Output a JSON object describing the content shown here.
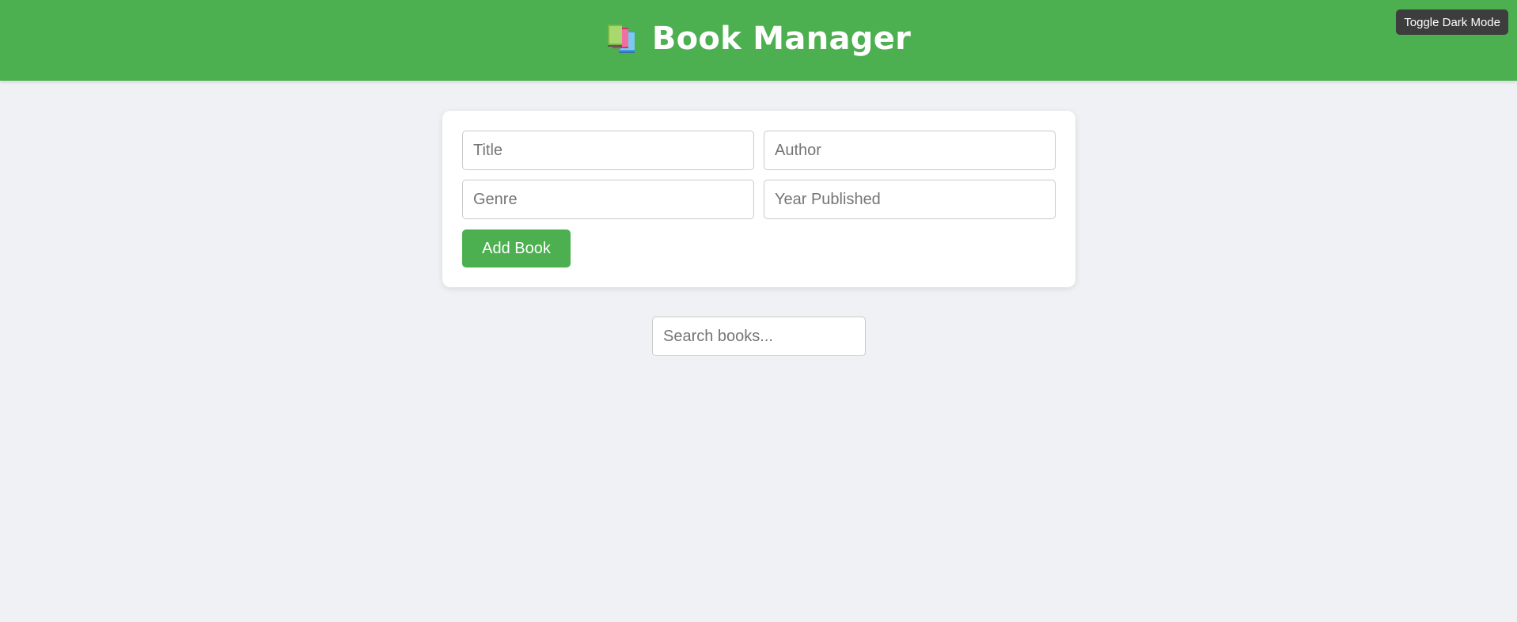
{
  "header": {
    "title": "Book Manager",
    "icon": "books-icon",
    "background": "#4caf50",
    "toggle_label": "Toggle Dark Mode"
  },
  "form": {
    "title_placeholder": "Title",
    "author_placeholder": "Author",
    "genre_placeholder": "Genre",
    "year_placeholder": "Year Published",
    "submit_label": "Add Book"
  },
  "search": {
    "placeholder": "Search books..."
  },
  "colors": {
    "accent": "#4caf50",
    "page_background": "#eff1f5",
    "toggle_background": "#3d3d3d"
  }
}
